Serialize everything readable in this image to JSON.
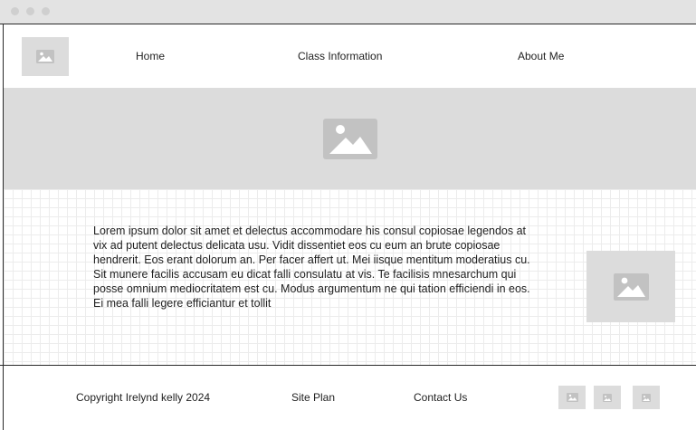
{
  "window": {
    "controls": [
      "close-dot",
      "minimize-dot",
      "maximize-dot"
    ]
  },
  "header": {
    "logo_icon": "image-placeholder-icon",
    "nav": [
      {
        "label": "Home"
      },
      {
        "label": "Class Information"
      },
      {
        "label": "About Me"
      }
    ]
  },
  "hero": {
    "icon": "image-placeholder-icon"
  },
  "main": {
    "paragraph": "Lorem ipsum dolor sit amet et delectus accommodare his consul copiosae legendos at vix ad putent delectus delicata usu. Vidit dissentiet eos cu eum an brute copiosae hendrerit. Eos erant dolorum an. Per facer affert ut. Mei iisque mentitum moderatius cu. Sit munere facilis accusam eu dicat falli consulatu at vis. Te facilisis mnesarchum qui posse omnium mediocritatem est cu. Modus argumentum ne qui tation efficiendi in eos. Ei mea falli legere efficiantur et tollit",
    "side_image_icon": "image-placeholder-icon"
  },
  "footer": {
    "copyright": "Copyright Irelynd kelly 2024",
    "site_plan": "Site Plan",
    "contact": "Contact Us",
    "social_icons": [
      "image-placeholder-icon",
      "image-placeholder-icon",
      "image-placeholder-icon"
    ]
  },
  "colors": {
    "placeholder_fill": "#dcdcdc",
    "placeholder_icon": "#ffffff",
    "border": "#2a2a2a",
    "grid": "#ececec"
  }
}
